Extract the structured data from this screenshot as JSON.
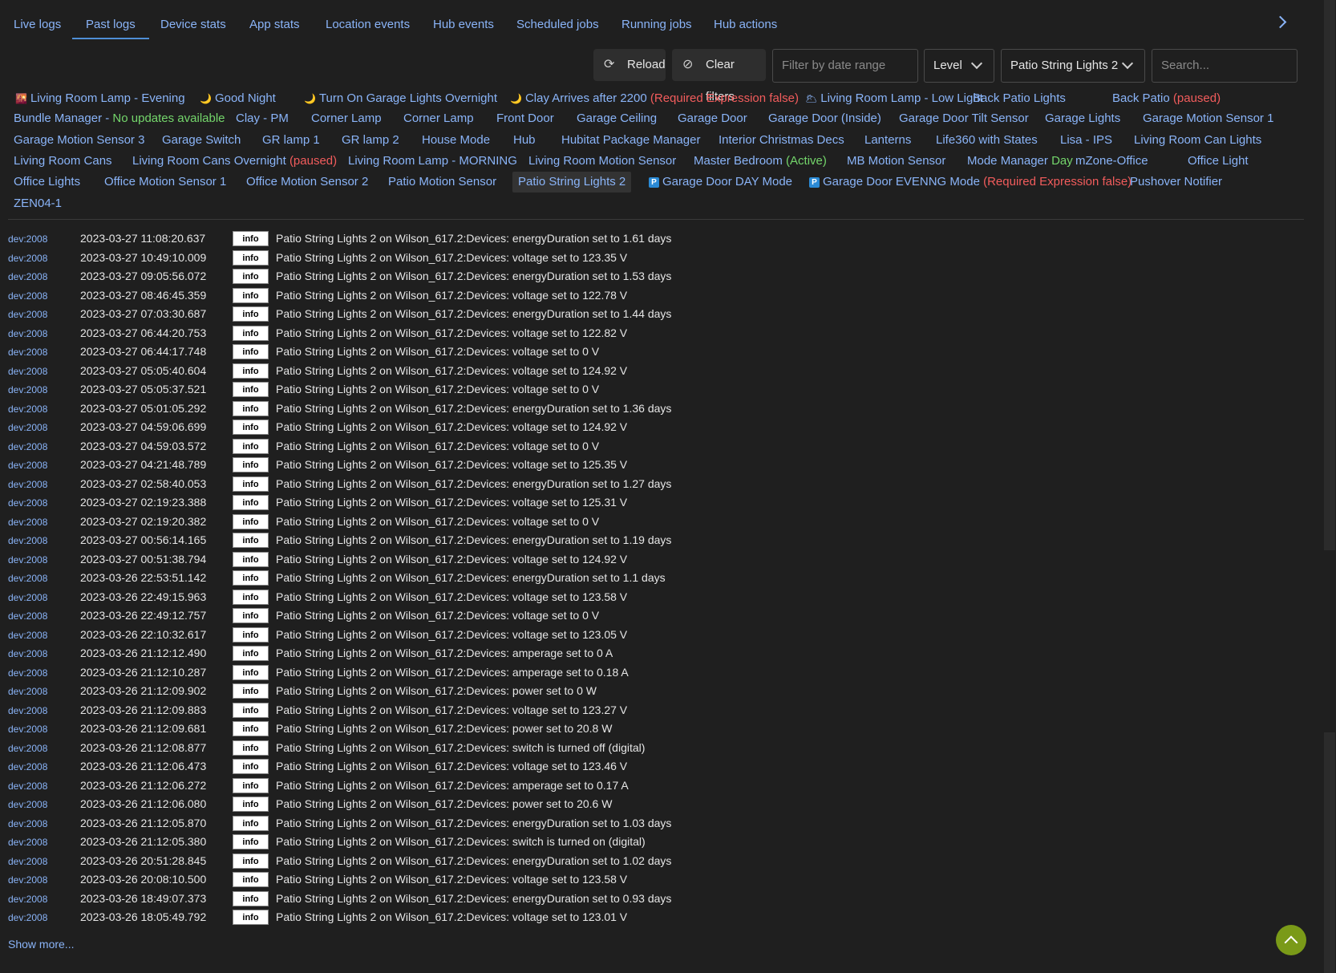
{
  "tabs": [
    "Live logs",
    "Past logs",
    "Device stats",
    "App stats",
    "Location events",
    "Hub events",
    "Scheduled jobs",
    "Running jobs",
    "Hub actions"
  ],
  "toolbar": {
    "reload_label": "Reload",
    "clear_label": "Clear filters",
    "date_placeholder": "Filter by date range",
    "level_label": "Level",
    "device_selected": "Patio String Lights 2",
    "search_placeholder": "Search..."
  },
  "apps": {
    "a1": {
      "label": "Living Room Lamp - Evening",
      "icon": "sunset-icon"
    },
    "a2": {
      "label": "Good Night",
      "icon": "moon-icon"
    },
    "a3": {
      "label": "Turn On Garage Lights Overnight",
      "icon": "moon-icon"
    },
    "a4": {
      "label": "Clay Arrives after 2200",
      "note": "(Required Expression false)",
      "icon": "moon-icon"
    },
    "a5": {
      "label": "Living Room Lamp - Low Light",
      "icon": "cloud-sun-icon"
    },
    "a6": {
      "label": "Back Patio Lights"
    },
    "a7": {
      "label": "Back Patio",
      "note": "(paused)"
    },
    "a8": {
      "label": "Bundle Manager -",
      "note": "No updates available"
    },
    "a9": {
      "label": "Clay - PM"
    },
    "a10": {
      "label": "Corner Lamp"
    },
    "a11": {
      "label": "Corner Lamp"
    },
    "a12": {
      "label": "Front Door"
    },
    "a13": {
      "label": "Garage Ceiling"
    },
    "a14": {
      "label": "Garage Door"
    },
    "a15": {
      "label": "Garage Door (Inside)"
    },
    "a16": {
      "label": "Garage Door Tilt Sensor"
    },
    "a17": {
      "label": "Garage Lights"
    },
    "a18": {
      "label": "Garage Motion Sensor 1"
    },
    "a19": {
      "label": "Garage Motion Sensor 3"
    },
    "a20": {
      "label": "Garage Switch"
    },
    "a21": {
      "label": "GR lamp 1"
    },
    "a22": {
      "label": "GR lamp 2"
    },
    "a23": {
      "label": "House Mode"
    },
    "a24": {
      "label": "Hub"
    },
    "a25": {
      "label": "Hubitat Package Manager"
    },
    "a26": {
      "label": "Interior Christmas Decs"
    },
    "a27": {
      "label": "Lanterns"
    },
    "a28": {
      "label": "Life360 with States"
    },
    "a29": {
      "label": "Lisa - IPS"
    },
    "a30": {
      "label": "Living Room Can Lights"
    },
    "a31": {
      "label": "Living Room Cans"
    },
    "a32": {
      "label": "Living Room Cans Overnight",
      "note": "(paused)"
    },
    "a33": {
      "label": "Living Room Lamp - MORNING"
    },
    "a34": {
      "label": "Living Room Motion Sensor"
    },
    "a35": {
      "label": "Master Bedroom",
      "note": "(Active)"
    },
    "a36": {
      "label": "MB Motion Sensor"
    },
    "a37": {
      "label": "Mode Manager",
      "note": "Day"
    },
    "a38": {
      "label": "mZone-Office"
    },
    "a39": {
      "label": "Office Light"
    },
    "a40": {
      "label": "Office Lights"
    },
    "a41": {
      "label": "Office Motion Sensor 1"
    },
    "a42": {
      "label": "Office Motion Sensor 2"
    },
    "a43": {
      "label": "Patio Motion Sensor"
    },
    "a44": {
      "label": "Patio String Lights 2"
    },
    "a45": {
      "label": "Garage Door DAY Mode",
      "badge": "P"
    },
    "a46": {
      "label": "Garage Door EVENNG Mode",
      "note": "(Required Expression false)",
      "badge": "P"
    },
    "a47": {
      "label": "Pushover Notifier"
    },
    "a48": {
      "label": "ZEN04-1"
    }
  },
  "logs": [
    {
      "dev": "dev:2008",
      "ts": "2023-03-27 11:08:20.637",
      "level": "info",
      "msg": "Patio String Lights 2 on Wilson_617.2:Devices: energyDuration set to 1.61 days"
    },
    {
      "dev": "dev:2008",
      "ts": "2023-03-27 10:49:10.009",
      "level": "info",
      "msg": "Patio String Lights 2 on Wilson_617.2:Devices: voltage set to 123.35 V"
    },
    {
      "dev": "dev:2008",
      "ts": "2023-03-27 09:05:56.072",
      "level": "info",
      "msg": "Patio String Lights 2 on Wilson_617.2:Devices: energyDuration set to 1.53 days"
    },
    {
      "dev": "dev:2008",
      "ts": "2023-03-27 08:46:45.359",
      "level": "info",
      "msg": "Patio String Lights 2 on Wilson_617.2:Devices: voltage set to 122.78 V"
    },
    {
      "dev": "dev:2008",
      "ts": "2023-03-27 07:03:30.687",
      "level": "info",
      "msg": "Patio String Lights 2 on Wilson_617.2:Devices: energyDuration set to 1.44 days"
    },
    {
      "dev": "dev:2008",
      "ts": "2023-03-27 06:44:20.753",
      "level": "info",
      "msg": "Patio String Lights 2 on Wilson_617.2:Devices: voltage set to 122.82 V"
    },
    {
      "dev": "dev:2008",
      "ts": "2023-03-27 06:44:17.748",
      "level": "info",
      "msg": "Patio String Lights 2 on Wilson_617.2:Devices: voltage set to 0 V"
    },
    {
      "dev": "dev:2008",
      "ts": "2023-03-27 05:05:40.604",
      "level": "info",
      "msg": "Patio String Lights 2 on Wilson_617.2:Devices: voltage set to 124.92 V"
    },
    {
      "dev": "dev:2008",
      "ts": "2023-03-27 05:05:37.521",
      "level": "info",
      "msg": "Patio String Lights 2 on Wilson_617.2:Devices: voltage set to 0 V"
    },
    {
      "dev": "dev:2008",
      "ts": "2023-03-27 05:01:05.292",
      "level": "info",
      "msg": "Patio String Lights 2 on Wilson_617.2:Devices: energyDuration set to 1.36 days"
    },
    {
      "dev": "dev:2008",
      "ts": "2023-03-27 04:59:06.699",
      "level": "info",
      "msg": "Patio String Lights 2 on Wilson_617.2:Devices: voltage set to 124.92 V"
    },
    {
      "dev": "dev:2008",
      "ts": "2023-03-27 04:59:03.572",
      "level": "info",
      "msg": "Patio String Lights 2 on Wilson_617.2:Devices: voltage set to 0 V"
    },
    {
      "dev": "dev:2008",
      "ts": "2023-03-27 04:21:48.789",
      "level": "info",
      "msg": "Patio String Lights 2 on Wilson_617.2:Devices: voltage set to 125.35 V"
    },
    {
      "dev": "dev:2008",
      "ts": "2023-03-27 02:58:40.053",
      "level": "info",
      "msg": "Patio String Lights 2 on Wilson_617.2:Devices: energyDuration set to 1.27 days"
    },
    {
      "dev": "dev:2008",
      "ts": "2023-03-27 02:19:23.388",
      "level": "info",
      "msg": "Patio String Lights 2 on Wilson_617.2:Devices: voltage set to 125.31 V"
    },
    {
      "dev": "dev:2008",
      "ts": "2023-03-27 02:19:20.382",
      "level": "info",
      "msg": "Patio String Lights 2 on Wilson_617.2:Devices: voltage set to 0 V"
    },
    {
      "dev": "dev:2008",
      "ts": "2023-03-27 00:56:14.165",
      "level": "info",
      "msg": "Patio String Lights 2 on Wilson_617.2:Devices: energyDuration set to 1.19 days"
    },
    {
      "dev": "dev:2008",
      "ts": "2023-03-27 00:51:38.794",
      "level": "info",
      "msg": "Patio String Lights 2 on Wilson_617.2:Devices: voltage set to 124.92 V"
    },
    {
      "dev": "dev:2008",
      "ts": "2023-03-26 22:53:51.142",
      "level": "info",
      "msg": "Patio String Lights 2 on Wilson_617.2:Devices: energyDuration set to 1.1 days"
    },
    {
      "dev": "dev:2008",
      "ts": "2023-03-26 22:49:15.963",
      "level": "info",
      "msg": "Patio String Lights 2 on Wilson_617.2:Devices: voltage set to 123.58 V"
    },
    {
      "dev": "dev:2008",
      "ts": "2023-03-26 22:49:12.757",
      "level": "info",
      "msg": "Patio String Lights 2 on Wilson_617.2:Devices: voltage set to 0 V"
    },
    {
      "dev": "dev:2008",
      "ts": "2023-03-26 22:10:32.617",
      "level": "info",
      "msg": "Patio String Lights 2 on Wilson_617.2:Devices: voltage set to 123.05 V"
    },
    {
      "dev": "dev:2008",
      "ts": "2023-03-26 21:12:12.490",
      "level": "info",
      "msg": "Patio String Lights 2 on Wilson_617.2:Devices: amperage set to 0 A"
    },
    {
      "dev": "dev:2008",
      "ts": "2023-03-26 21:12:10.287",
      "level": "info",
      "msg": "Patio String Lights 2 on Wilson_617.2:Devices: amperage set to 0.18 A"
    },
    {
      "dev": "dev:2008",
      "ts": "2023-03-26 21:12:09.902",
      "level": "info",
      "msg": "Patio String Lights 2 on Wilson_617.2:Devices: power set to 0 W"
    },
    {
      "dev": "dev:2008",
      "ts": "2023-03-26 21:12:09.883",
      "level": "info",
      "msg": "Patio String Lights 2 on Wilson_617.2:Devices: voltage set to 123.27 V"
    },
    {
      "dev": "dev:2008",
      "ts": "2023-03-26 21:12:09.681",
      "level": "info",
      "msg": "Patio String Lights 2 on Wilson_617.2:Devices: power set to 20.8 W"
    },
    {
      "dev": "dev:2008",
      "ts": "2023-03-26 21:12:08.877",
      "level": "info",
      "msg": "Patio String Lights 2 on Wilson_617.2:Devices: switch is turned off (digital)"
    },
    {
      "dev": "dev:2008",
      "ts": "2023-03-26 21:12:06.473",
      "level": "info",
      "msg": "Patio String Lights 2 on Wilson_617.2:Devices: voltage set to 123.46 V"
    },
    {
      "dev": "dev:2008",
      "ts": "2023-03-26 21:12:06.272",
      "level": "info",
      "msg": "Patio String Lights 2 on Wilson_617.2:Devices: amperage set to 0.17 A"
    },
    {
      "dev": "dev:2008",
      "ts": "2023-03-26 21:12:06.080",
      "level": "info",
      "msg": "Patio String Lights 2 on Wilson_617.2:Devices: power set to 20.6 W"
    },
    {
      "dev": "dev:2008",
      "ts": "2023-03-26 21:12:05.870",
      "level": "info",
      "msg": "Patio String Lights 2 on Wilson_617.2:Devices: energyDuration set to 1.03 days"
    },
    {
      "dev": "dev:2008",
      "ts": "2023-03-26 21:12:05.380",
      "level": "info",
      "msg": "Patio String Lights 2 on Wilson_617.2:Devices: switch is turned on (digital)"
    },
    {
      "dev": "dev:2008",
      "ts": "2023-03-26 20:51:28.845",
      "level": "info",
      "msg": "Patio String Lights 2 on Wilson_617.2:Devices: energyDuration set to 1.02 days"
    },
    {
      "dev": "dev:2008",
      "ts": "2023-03-26 20:08:10.500",
      "level": "info",
      "msg": "Patio String Lights 2 on Wilson_617.2:Devices: voltage set to 123.58 V"
    },
    {
      "dev": "dev:2008",
      "ts": "2023-03-26 18:49:07.373",
      "level": "info",
      "msg": "Patio String Lights 2 on Wilson_617.2:Devices: energyDuration set to 0.93 days"
    },
    {
      "dev": "dev:2008",
      "ts": "2023-03-26 18:05:49.792",
      "level": "info",
      "msg": "Patio String Lights 2 on Wilson_617.2:Devices: voltage set to 123.01 V"
    }
  ],
  "show_more_label": "Show more...",
  "colors": {
    "link": "#8ab4f8",
    "warning": "#f25c5c",
    "success": "#74d66b",
    "background": "#1f1f1f",
    "accent": "#7a9a18"
  }
}
